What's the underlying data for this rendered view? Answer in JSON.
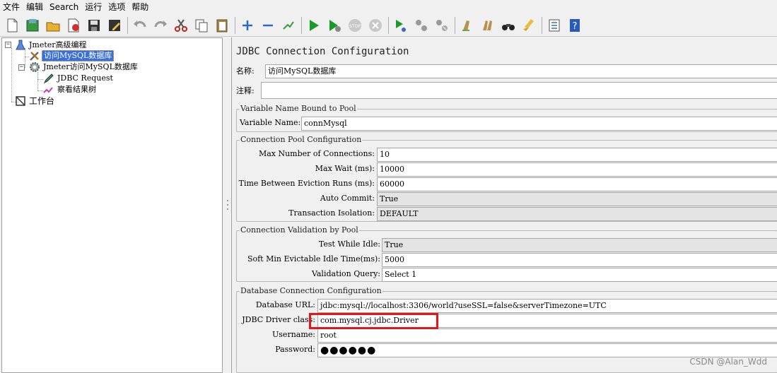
{
  "menu": [
    "文件",
    "编辑",
    "Search",
    "运行",
    "选项",
    "帮助"
  ],
  "toolbar_icons": [
    "new-file-icon",
    "templates-icon",
    "open-icon",
    "close-icon",
    "save-icon",
    "save-as-icon",
    "undo-icon",
    "redo-icon",
    "cut-icon",
    "copy-icon",
    "paste-icon",
    "expand-icon",
    "collapse-icon",
    "toggle-icon",
    "start-icon",
    "start-no-pause-icon",
    "stop-icon",
    "shutdown-icon",
    "remote-start-icon",
    "remote-stop-icon",
    "remote-shutdown-icon",
    "clear-icon",
    "clear-all-icon",
    "search-icon",
    "reset-search-icon",
    "function-helper-icon",
    "help-icon"
  ],
  "tree": {
    "test_plan": "Jmeter高级编程",
    "config": "访问MySQL数据库",
    "thread_group": "Jmeter访问MySQL数据库",
    "sampler": "JDBC Request",
    "listener": "察看结果树",
    "workbench": "工作台"
  },
  "panel": {
    "title": "JDBC Connection Configuration",
    "name_label": "名称:",
    "name_value": "访问MySQL数据库",
    "comment_label": "注释:",
    "comment_value": ""
  },
  "variable_group": {
    "title": "Variable Name Bound to Pool",
    "var_label": "Variable Name:",
    "var_value": "connMysql"
  },
  "pool_group": {
    "title": "Connection Pool Configuration",
    "max_conn_label": "Max Number of Connections:",
    "max_conn_value": "10",
    "max_wait_label": "Max Wait (ms):",
    "max_wait_value": "10000",
    "eviction_label": "Time Between Eviction Runs (ms):",
    "eviction_value": "60000",
    "auto_commit_label": "Auto Commit:",
    "auto_commit_value": "True",
    "isolation_label": "Transaction Isolation:",
    "isolation_value": "DEFAULT"
  },
  "validation_group": {
    "title": "Connection Validation by Pool",
    "idle_label": "Test While Idle:",
    "idle_value": "True",
    "soft_min_label": "Soft Min Evictable Idle Time(ms):",
    "soft_min_value": "5000",
    "query_label": "Validation Query:",
    "query_value": "Select 1"
  },
  "db_group": {
    "title": "Database Connection Configuration",
    "url_label": "Database URL:",
    "url_value": "jdbc:mysql://localhost:3306/world?useSSL=false&serverTimezone=UTC",
    "driver_label": "JDBC Driver class:",
    "driver_value": "com.mysql.cj.jdbc.Driver",
    "user_label": "Username:",
    "user_value": "root",
    "password_label": "Password:",
    "password_value": "●●●●●●"
  },
  "colors": {
    "highlight": "#e01818",
    "selection": "#3a6fd8"
  },
  "watermark": "CSDN @Alan_Wdd"
}
